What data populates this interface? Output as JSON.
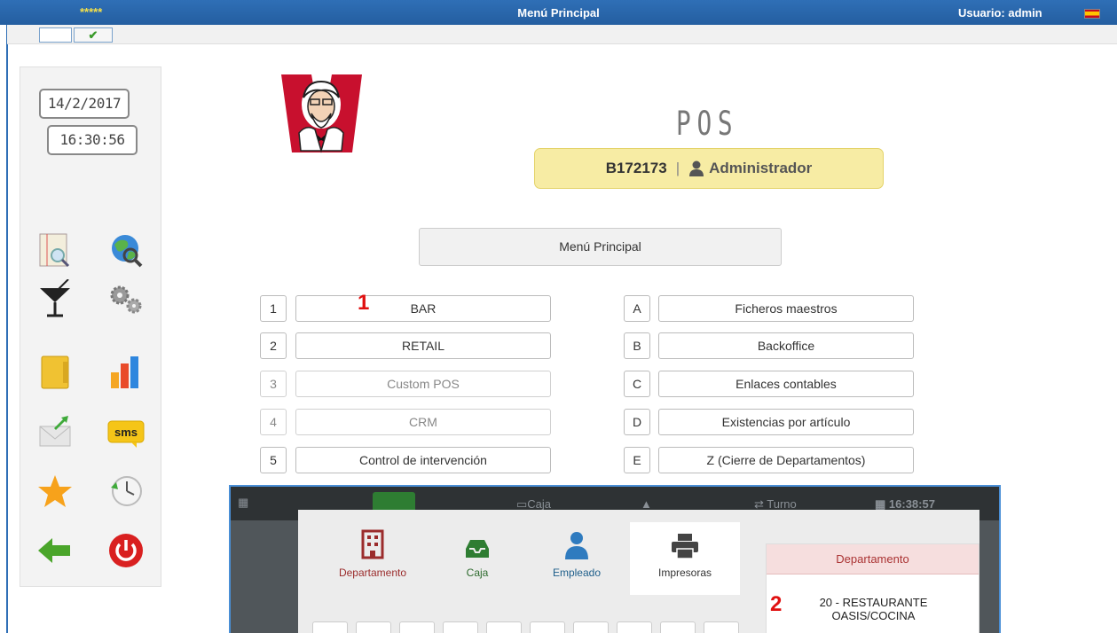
{
  "topbar": {
    "stars": "*****",
    "title": "Menú Principal",
    "user": "Usuario: admin",
    "flag_icon": "spain-flag-icon",
    "check_icon": "check-icon"
  },
  "sidebar": {
    "date": "14/2/2017",
    "time": "16:30:56",
    "icons": [
      "document-search-icon",
      "globe-search-icon",
      "cocktail-icon",
      "gears-icon",
      "folder-icon",
      "bar-chart-icon",
      "mail-send-icon",
      "sms-icon",
      "star-icon",
      "clock-history-icon",
      "back-arrow-icon",
      "power-icon"
    ],
    "sms_label": "sms"
  },
  "header": {
    "logo_icon": "kfc-colonel-logo",
    "pos": "POS",
    "code": "B172173",
    "separator": "|",
    "role": "Administrador",
    "menu_title": "Menú Principal"
  },
  "menu_left": [
    {
      "key": "1",
      "label": "BAR"
    },
    {
      "key": "2",
      "label": "RETAIL"
    },
    {
      "key": "3",
      "label": "Custom POS"
    },
    {
      "key": "4",
      "label": "CRM"
    },
    {
      "key": "5",
      "label": "Control de intervención"
    }
  ],
  "menu_right": [
    {
      "key": "A",
      "label": "Ficheros maestros"
    },
    {
      "key": "B",
      "label": "Backoffice"
    },
    {
      "key": "C",
      "label": "Enlaces contables"
    },
    {
      "key": "D",
      "label": "Existencias por artículo"
    },
    {
      "key": "E",
      "label": "Z (Cierre de Departamentos)"
    }
  ],
  "annotations": {
    "one": "1",
    "two": "2"
  },
  "overlay": {
    "top_caja": "Caja",
    "top_turno": "Turno",
    "top_time": "16:38:57",
    "tabs": [
      "Departamento",
      "Caja",
      "Empleado",
      "Impresoras"
    ],
    "dept_header": "Departamento",
    "dept_line1": "20 - RESTAURANTE",
    "dept_line2": "OASIS/COCINA"
  },
  "colors": {
    "accent": "#2f6fb6",
    "badge": "#f7eca4",
    "red_tag": "#e01010"
  }
}
